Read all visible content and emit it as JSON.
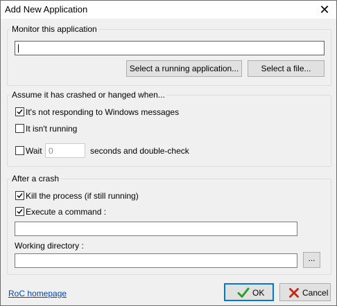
{
  "window": {
    "title": "Add New Application",
    "close_glyph": "✕"
  },
  "monitor": {
    "legend": "Monitor this application",
    "app_path_value": "",
    "select_running_label": "Select a running application...",
    "select_file_label": "Select a file..."
  },
  "crash_conditions": {
    "legend": "Assume it has crashed or hanged when...",
    "not_responding": {
      "label": "It's not responding to Windows messages",
      "checked": true
    },
    "not_running": {
      "label": "It isn't running",
      "checked": false
    },
    "wait": {
      "label": "Wait",
      "checked": false,
      "value": "0",
      "suffix": "seconds and double-check"
    }
  },
  "after_crash": {
    "legend": "After a crash",
    "kill_process": {
      "label": "Kill the process (if still running)",
      "checked": true
    },
    "execute_command": {
      "label": "Execute a command :",
      "checked": true
    },
    "command_value": "",
    "working_dir_label": "Working directory :",
    "working_dir_value": "",
    "browse_label": "..."
  },
  "footer": {
    "homepage_link": "RoC homepage",
    "ok_label": "OK",
    "cancel_label": "Cancel"
  },
  "colors": {
    "accent": "#0078d7",
    "ok_check": "#2a9d2a",
    "cancel_x": "#c42b1c",
    "link": "#0645ad"
  }
}
